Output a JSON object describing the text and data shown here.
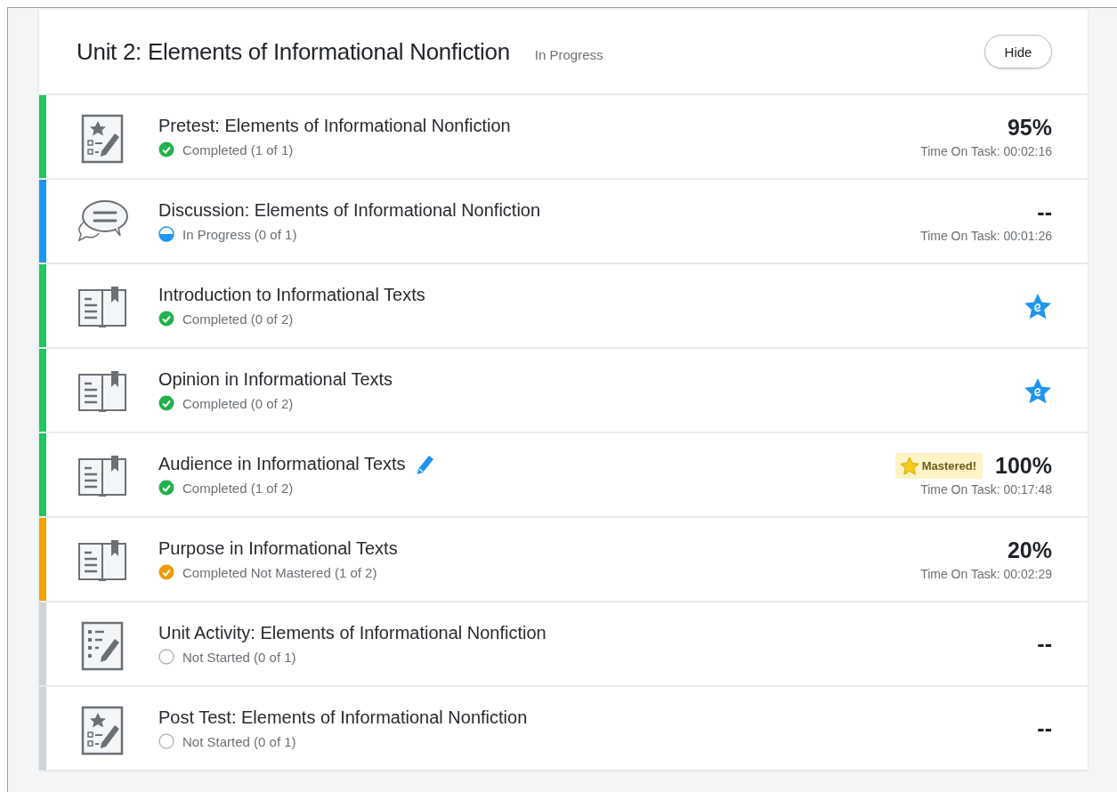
{
  "unit": {
    "title": "Unit 2: Elements of Informational Nonfiction",
    "status": "In Progress",
    "hide_button": "Hide"
  },
  "rows": [
    {
      "kind": "test",
      "title": "Pretest: Elements of Informational Nonfiction",
      "edited": false,
      "status": {
        "kind": "completed",
        "text": "Completed (1 of 1)"
      },
      "color": "#22c55e",
      "score": "95%",
      "time": "Time On Task: 00:02:16"
    },
    {
      "kind": "discussion",
      "title": "Discussion: Elements of Informational Nonfiction",
      "edited": false,
      "status": {
        "kind": "in_progress",
        "text": "In Progress (0 of 1)"
      },
      "color": "#1e96f0",
      "score": "--",
      "time": "Time On Task: 00:01:26"
    },
    {
      "kind": "lesson",
      "title": "Introduction to Informational Texts",
      "edited": false,
      "status": {
        "kind": "completed",
        "text": "Completed (0 of 2)"
      },
      "color": "#22c55e",
      "award": true
    },
    {
      "kind": "lesson",
      "title": "Opinion in Informational Texts",
      "edited": false,
      "status": {
        "kind": "completed",
        "text": "Completed (0 of 2)"
      },
      "color": "#22c55e",
      "award": true
    },
    {
      "kind": "lesson",
      "title": "Audience in Informational Texts",
      "edited": true,
      "status": {
        "kind": "completed",
        "text": "Completed (1 of 2)"
      },
      "color": "#22c55e",
      "badge": "Mastered!",
      "score": "100%",
      "time": "Time On Task: 00:17:48"
    },
    {
      "kind": "lesson",
      "title": "Purpose in Informational Texts",
      "edited": false,
      "status": {
        "kind": "not_mastered",
        "text": "Completed Not Mastered (1 of 2)"
      },
      "color": "#f5a000",
      "score": "20%",
      "time": "Time On Task: 00:02:29"
    },
    {
      "kind": "activity",
      "title": "Unit Activity: Elements of Informational Nonfiction",
      "edited": false,
      "status": {
        "kind": "not_started",
        "text": "Not Started (0 of 1)"
      },
      "color": "#cfd3d7",
      "score": "--"
    },
    {
      "kind": "test",
      "title": "Post Test: Elements of Informational Nonfiction",
      "edited": false,
      "status": {
        "kind": "not_started",
        "text": "Not Started (0 of 1)"
      },
      "color": "#cfd3d7",
      "score": "--"
    }
  ]
}
